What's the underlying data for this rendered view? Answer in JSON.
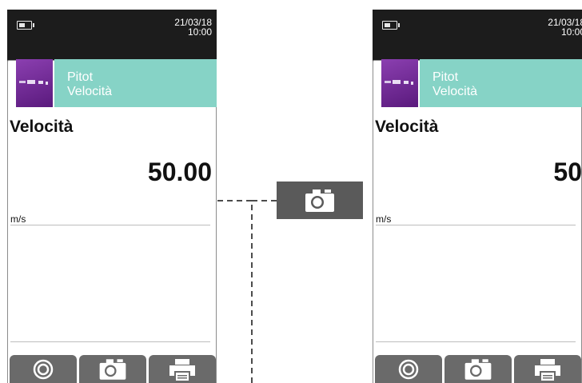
{
  "status": {
    "date": "21/03/18",
    "time": "10:00"
  },
  "header": {
    "line1": "Pitot",
    "line2": "Velocità"
  },
  "measurement": {
    "name": "Velocità",
    "value": "50.00",
    "value_truncated": "50",
    "unit": "m/s"
  },
  "buttons": [
    {
      "icon": "target-icon"
    },
    {
      "icon": "camera-icon"
    },
    {
      "icon": "printer-icon"
    }
  ],
  "center_action": {
    "icon": "camera-icon"
  },
  "colors": {
    "device_bg": "#1c1c1c",
    "header_teal": "#86d3c6",
    "thumb_purple": "#6b2a8f",
    "button_gray": "#6a6a6a"
  }
}
